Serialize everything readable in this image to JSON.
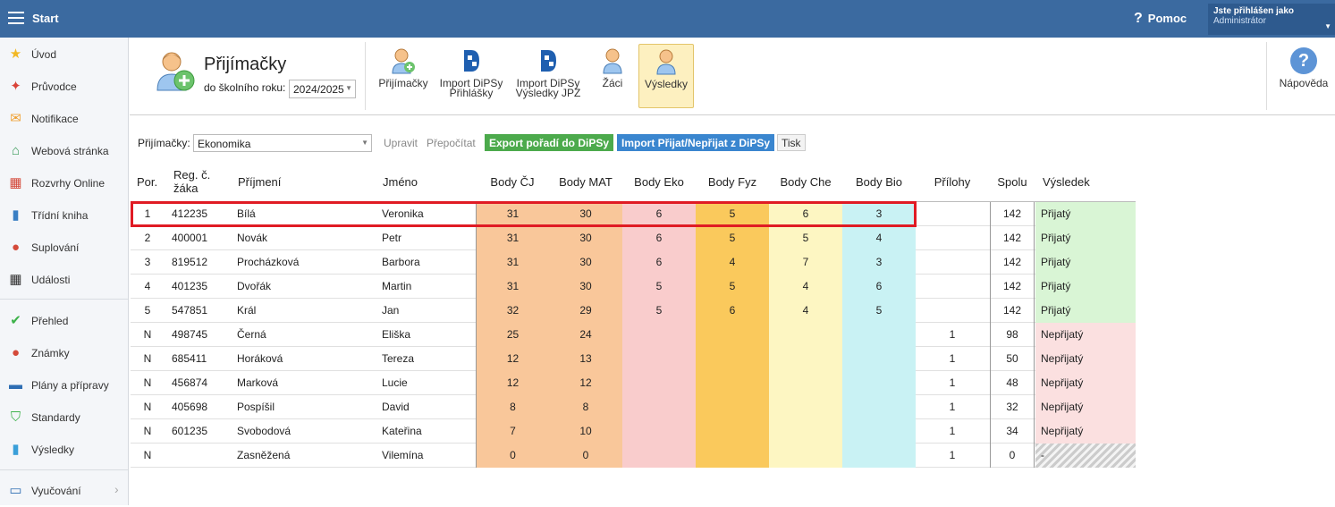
{
  "topbar": {
    "start_label": "Start",
    "help_label": "Pomoc",
    "user_line1": "Jste přihlášen jako",
    "user_line2": "Administrátor"
  },
  "sidebar": {
    "items": [
      {
        "label": "Úvod",
        "icon": "star-icon"
      },
      {
        "label": "Průvodce",
        "icon": "wand-icon"
      },
      {
        "label": "Notifikace",
        "icon": "envelope-icon"
      },
      {
        "label": "Webová stránka",
        "icon": "home-icon"
      },
      {
        "label": "Rozvrhy Online",
        "icon": "calendar-icon"
      },
      {
        "label": "Třídní kniha",
        "icon": "book-icon"
      },
      {
        "label": "Suplování",
        "icon": "person-icon"
      },
      {
        "label": "Události",
        "icon": "calendar-dark-icon"
      },
      {
        "label": "Přehled",
        "icon": "check-circle-icon"
      },
      {
        "label": "Známky",
        "icon": "grade-icon"
      },
      {
        "label": "Plány a přípravy",
        "icon": "briefcase-icon"
      },
      {
        "label": "Standardy",
        "icon": "shield-icon"
      },
      {
        "label": "Výsledky",
        "icon": "bar-chart-icon"
      },
      {
        "label": "Vyučování",
        "icon": "open-book-icon"
      }
    ]
  },
  "ribbon": {
    "title": "Přijímačky",
    "year_label": "do školního roku:",
    "year_value": "2024/2025",
    "buttons": [
      {
        "label1": "Přijímačky",
        "label2": ""
      },
      {
        "label1": "Import DiPSy",
        "label2": "Přihlášky"
      },
      {
        "label1": "Import DiPSy",
        "label2": "Výsledky JPZ"
      },
      {
        "label1": "Žáci",
        "label2": ""
      },
      {
        "label1": "Výsledky",
        "label2": ""
      }
    ],
    "help_label": "Nápověda"
  },
  "filter": {
    "label": "Přijímačky:",
    "value": "Ekonomika",
    "edit": "Upravit",
    "recalc": "Přepočítat",
    "export": "Export pořadí do DiPSy",
    "import": "Import Přijat/Nepřijat z DiPSy",
    "print": "Tisk"
  },
  "table": {
    "headers": {
      "por": "Por.",
      "reg1": "Reg. č.",
      "reg2": "žáka",
      "prijmeni": "Příjmení",
      "jmeno": "Jméno",
      "cj": "Body ČJ",
      "mat": "Body MAT",
      "eko": "Body Eko",
      "fyz": "Body Fyz",
      "che": "Body Che",
      "bio": "Body Bio",
      "prilohy": "Přílohy",
      "spolu": "Spolu",
      "vysledek": "Výsledek"
    },
    "rows": [
      {
        "por": "1",
        "reg": "412235",
        "prijmeni": "Bílá",
        "jmeno": "Veronika",
        "cj": "31",
        "mat": "30",
        "eko": "6",
        "fyz": "5",
        "che": "6",
        "bio": "3",
        "prilohy": "",
        "spolu": "142",
        "vysledek": "Přijatý",
        "status": "accepted"
      },
      {
        "por": "2",
        "reg": "400001",
        "prijmeni": "Novák",
        "jmeno": "Petr",
        "cj": "31",
        "mat": "30",
        "eko": "6",
        "fyz": "5",
        "che": "5",
        "bio": "4",
        "prilohy": "",
        "spolu": "142",
        "vysledek": "Přijatý",
        "status": "accepted"
      },
      {
        "por": "3",
        "reg": "819512",
        "prijmeni": "Procházková",
        "jmeno": "Barbora",
        "cj": "31",
        "mat": "30",
        "eko": "6",
        "fyz": "4",
        "che": "7",
        "bio": "3",
        "prilohy": "",
        "spolu": "142",
        "vysledek": "Přijatý",
        "status": "accepted"
      },
      {
        "por": "4",
        "reg": "401235",
        "prijmeni": "Dvořák",
        "jmeno": "Martin",
        "cj": "31",
        "mat": "30",
        "eko": "5",
        "fyz": "5",
        "che": "4",
        "bio": "6",
        "prilohy": "",
        "spolu": "142",
        "vysledek": "Přijatý",
        "status": "accepted"
      },
      {
        "por": "5",
        "reg": "547851",
        "prijmeni": "Král",
        "jmeno": "Jan",
        "cj": "32",
        "mat": "29",
        "eko": "5",
        "fyz": "6",
        "che": "4",
        "bio": "5",
        "prilohy": "",
        "spolu": "142",
        "vysledek": "Přijatý",
        "status": "accepted"
      },
      {
        "por": "N",
        "reg": "498745",
        "prijmeni": "Černá",
        "jmeno": "Eliška",
        "cj": "25",
        "mat": "24",
        "eko": "",
        "fyz": "",
        "che": "",
        "bio": "",
        "prilohy": "1",
        "spolu": "98",
        "vysledek": "Nepřijatý",
        "status": "rejected"
      },
      {
        "por": "N",
        "reg": "685411",
        "prijmeni": "Horáková",
        "jmeno": "Tereza",
        "cj": "12",
        "mat": "13",
        "eko": "",
        "fyz": "",
        "che": "",
        "bio": "",
        "prilohy": "1",
        "spolu": "50",
        "vysledek": "Nepřijatý",
        "status": "rejected"
      },
      {
        "por": "N",
        "reg": "456874",
        "prijmeni": "Marková",
        "jmeno": "Lucie",
        "cj": "12",
        "mat": "12",
        "eko": "",
        "fyz": "",
        "che": "",
        "bio": "",
        "prilohy": "1",
        "spolu": "48",
        "vysledek": "Nepřijatý",
        "status": "rejected"
      },
      {
        "por": "N",
        "reg": "405698",
        "prijmeni": "Pospíšil",
        "jmeno": "David",
        "cj": "8",
        "mat": "8",
        "eko": "",
        "fyz": "",
        "che": "",
        "bio": "",
        "prilohy": "1",
        "spolu": "32",
        "vysledek": "Nepřijatý",
        "status": "rejected"
      },
      {
        "por": "N",
        "reg": "601235",
        "prijmeni": "Svobodová",
        "jmeno": "Kateřina",
        "cj": "7",
        "mat": "10",
        "eko": "",
        "fyz": "",
        "che": "",
        "bio": "",
        "prilohy": "1",
        "spolu": "34",
        "vysledek": "Nepřijatý",
        "status": "rejected"
      },
      {
        "por": "N",
        "reg": "",
        "prijmeni": "Zasněžená",
        "jmeno": "Vilemína",
        "cj": "0",
        "mat": "0",
        "eko": "",
        "fyz": "",
        "che": "",
        "bio": "",
        "prilohy": "1",
        "spolu": "0",
        "vysledek": "-",
        "status": "unknown"
      }
    ]
  },
  "colors": {
    "topbar": "#3b6aa0",
    "cj": "#f9c79a",
    "mat": "#f9c79a",
    "eko": "#f9cccc",
    "fyz": "#fac95c",
    "che": "#fdf6c2",
    "bio": "#c9f2f4",
    "accepted": "#d9f5d5",
    "rejected": "#fbe0e0",
    "highlight": "#e01b24"
  }
}
